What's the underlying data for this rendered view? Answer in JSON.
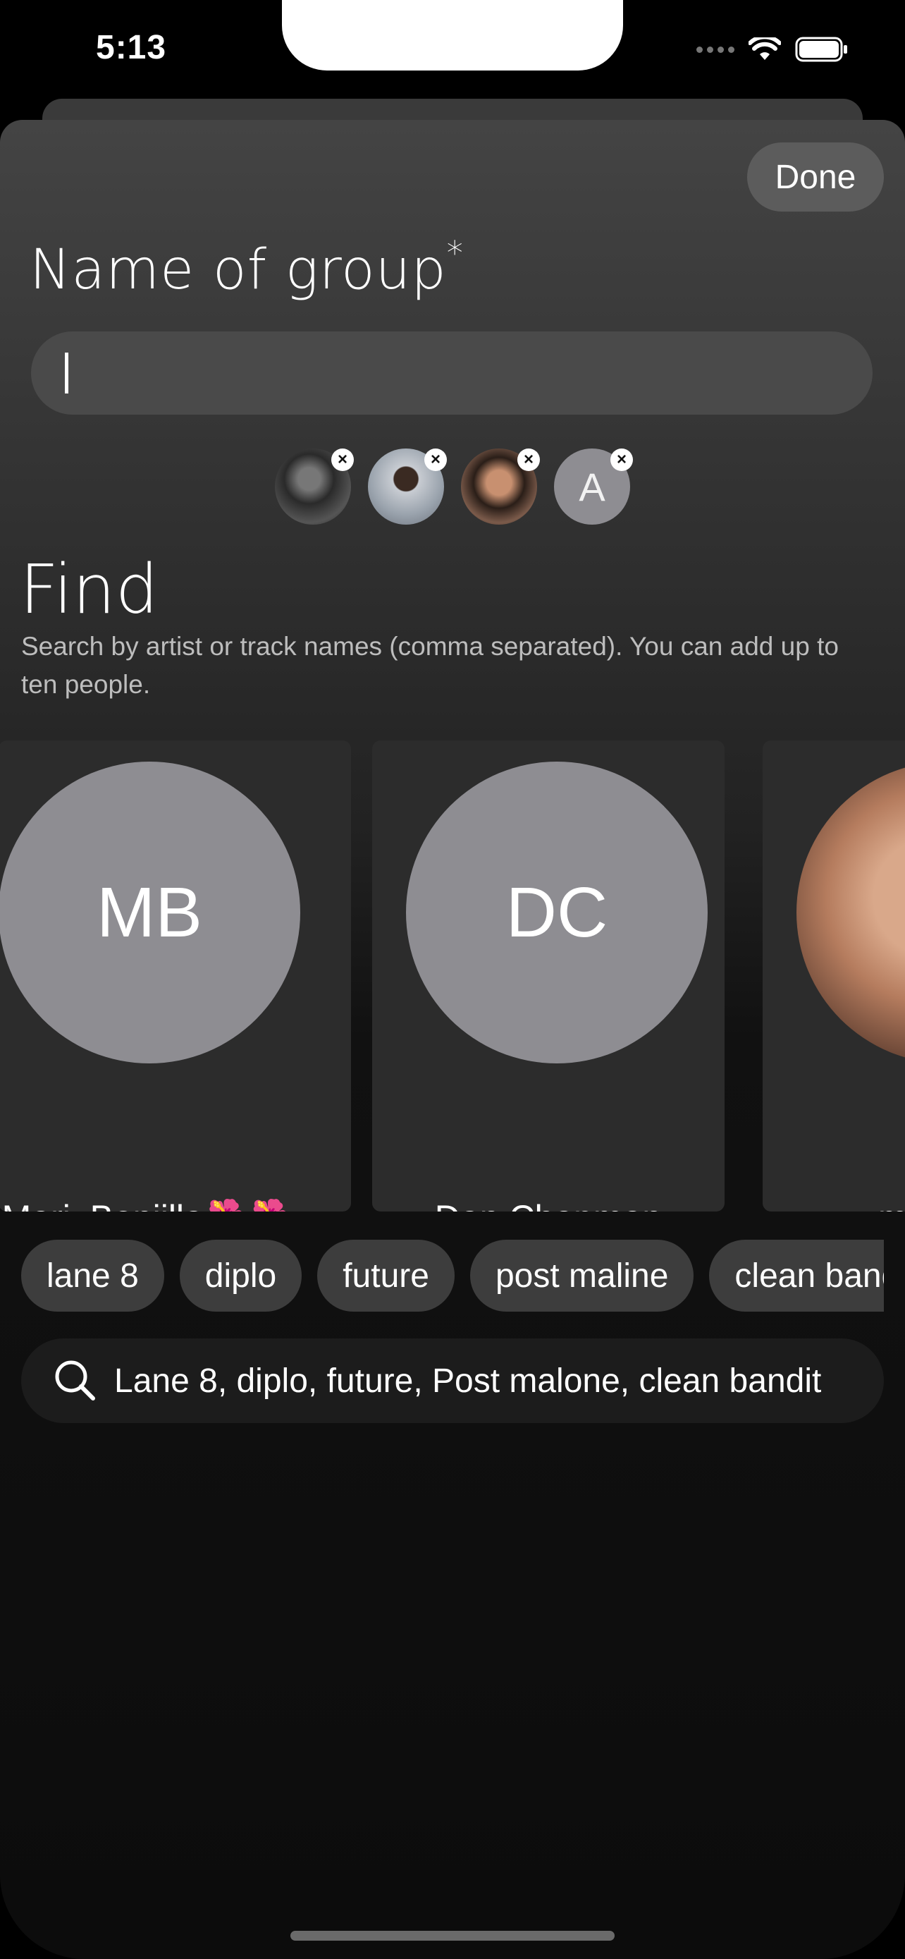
{
  "status_bar": {
    "time": "5:13"
  },
  "header": {
    "done_label": "Done"
  },
  "group": {
    "title": "Name of group",
    "required_mark": "*",
    "name_value": ""
  },
  "selected_people": [
    {
      "kind": "photo",
      "color": "#3a3a3a"
    },
    {
      "kind": "photo",
      "color": "#9aa3ad"
    },
    {
      "kind": "photo",
      "color": "#7a5a4a"
    },
    {
      "kind": "letter",
      "letter": "A"
    }
  ],
  "find": {
    "title": "Find",
    "subtitle": "Search by artist or track names (comma separated). You can add up to ten people."
  },
  "people": [
    {
      "initials": "MB",
      "name": "Mari. Boniilla🌺🌺",
      "artists": [
        "#2a8a4a",
        "#e04a8a",
        "#1a3a5a",
        "#b02a1a",
        "#444444",
        "#d07a30"
      ]
    },
    {
      "initials": "DC",
      "name": "Dan Chapman",
      "artists": [
        "#1a3a5a",
        "#2a5a4a",
        "#6a5a4a",
        "#b04a2a",
        "#d0d0d0",
        "#8a2a2a"
      ]
    },
    {
      "initials": "",
      "name": "m",
      "artists": [
        "#888888",
        "#333333"
      ]
    }
  ],
  "search_tags": [
    "lane 8",
    "diplo",
    "future",
    "post maline",
    "clean bandit"
  ],
  "search": {
    "value": "Lane 8, diplo, future, Post malone, clean bandit"
  }
}
